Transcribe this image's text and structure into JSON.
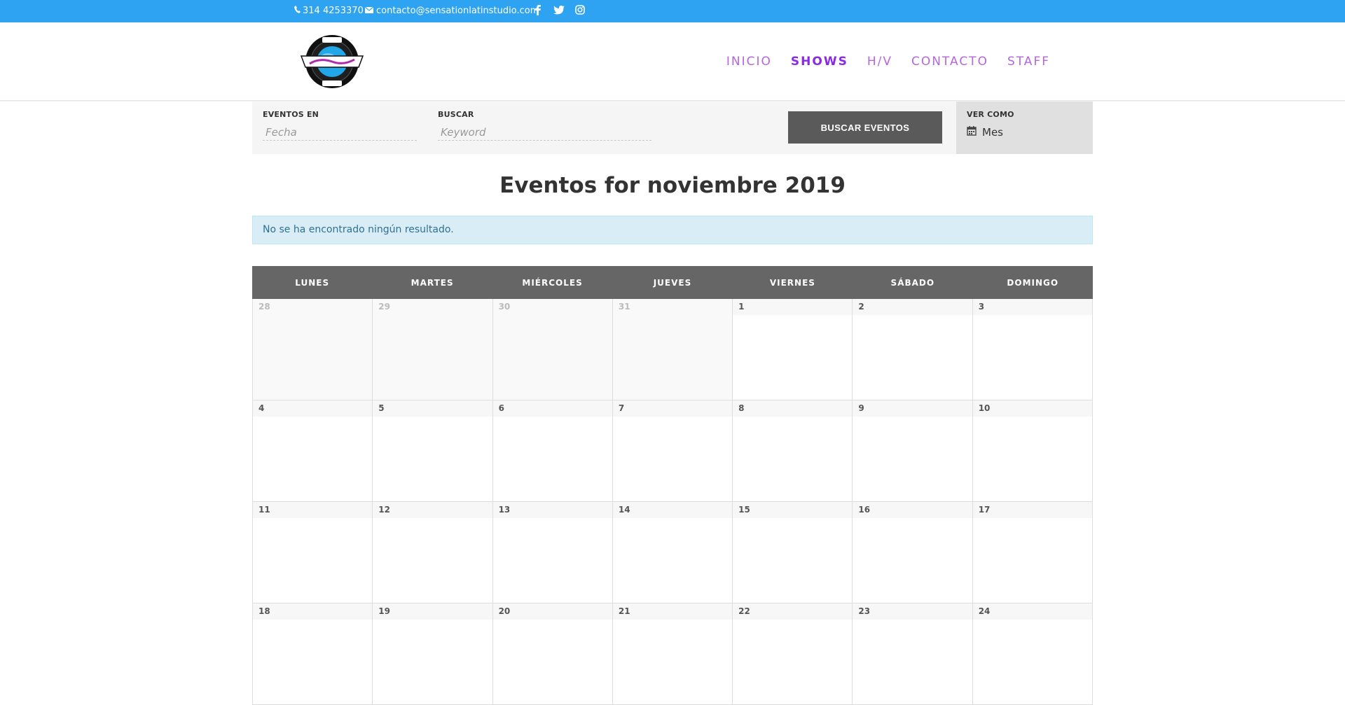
{
  "topbar": {
    "phone": "314 4253370",
    "email": "contacto@sensationlatinstudio.com",
    "social": [
      "facebook-icon",
      "twitter-icon",
      "instagram-icon"
    ],
    "color": "#2ea3f2"
  },
  "nav": {
    "items": [
      {
        "label": "INICIO",
        "active": false
      },
      {
        "label": "SHOWS",
        "active": true
      },
      {
        "label": "H/V",
        "active": false
      },
      {
        "label": "CONTACTO",
        "active": false
      },
      {
        "label": "STAFF",
        "active": false
      }
    ],
    "color": "#b565e0",
    "active_color": "#8a2be2"
  },
  "filters": {
    "date_label": "EVENTOS EN",
    "date_placeholder": "Fecha",
    "search_label": "BUSCAR",
    "search_placeholder": "Keyword",
    "button_label": "BUSCAR EVENTOS",
    "view_label": "VER COMO",
    "view_value": "Mes"
  },
  "title": "Eventos for noviembre 2019",
  "notice": "No se ha encontrado ningún resultado.",
  "calendar": {
    "days": [
      "LUNES",
      "MARTES",
      "MIÉRCOLES",
      "JUEVES",
      "VIERNES",
      "SÁBADO",
      "DOMINGO"
    ],
    "weeks": [
      [
        {
          "n": "28",
          "past": true
        },
        {
          "n": "29",
          "past": true
        },
        {
          "n": "30",
          "past": true
        },
        {
          "n": "31",
          "past": true
        },
        {
          "n": "1"
        },
        {
          "n": "2"
        },
        {
          "n": "3"
        }
      ],
      [
        {
          "n": "4"
        },
        {
          "n": "5"
        },
        {
          "n": "6"
        },
        {
          "n": "7"
        },
        {
          "n": "8"
        },
        {
          "n": "9"
        },
        {
          "n": "10"
        }
      ],
      [
        {
          "n": "11"
        },
        {
          "n": "12"
        },
        {
          "n": "13"
        },
        {
          "n": "14"
        },
        {
          "n": "15"
        },
        {
          "n": "16"
        },
        {
          "n": "17"
        }
      ],
      [
        {
          "n": "18"
        },
        {
          "n": "19"
        },
        {
          "n": "20"
        },
        {
          "n": "21"
        },
        {
          "n": "22"
        },
        {
          "n": "23"
        },
        {
          "n": "24"
        }
      ]
    ]
  }
}
